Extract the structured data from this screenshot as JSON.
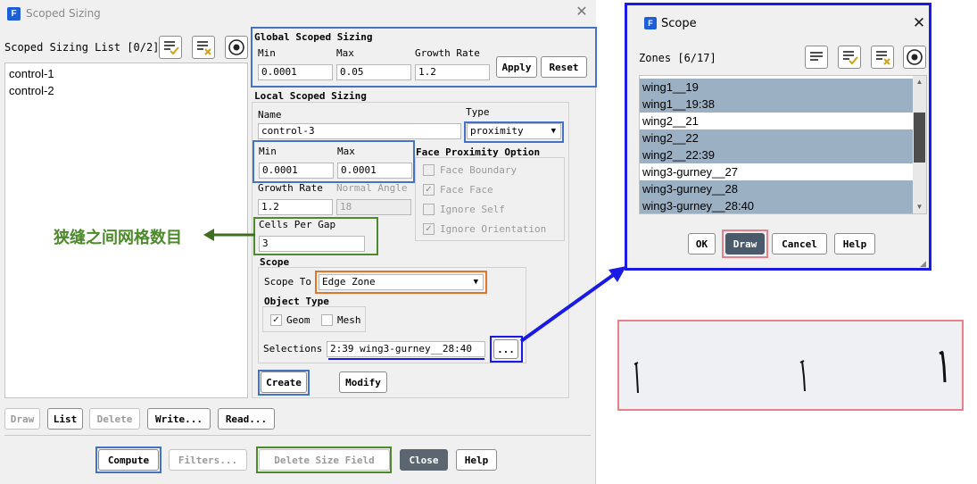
{
  "main_dialog": {
    "title": "Scoped Sizing",
    "close_icon": "close-icon",
    "list_label": "Scoped Sizing List [0/2]",
    "list_items": [
      "control-1",
      "control-2"
    ],
    "global": {
      "title": "Global Scoped Sizing",
      "min_label": "Min",
      "max_label": "Max",
      "growth_label": "Growth Rate",
      "min_value": "0.0001",
      "max_value": "0.05",
      "growth_value": "1.2",
      "apply": "Apply",
      "reset": "Reset"
    },
    "local": {
      "title": "Local Scoped Sizing",
      "name_label": "Name",
      "name_value": "control-3",
      "type_label": "Type",
      "type_value": "proximity",
      "min_label": "Min",
      "max_label": "Max",
      "min_value": "0.0001",
      "max_value": "0.0001",
      "growth_label": "Growth Rate",
      "growth_value": "1.2",
      "normal_angle_label": "Normal Angle",
      "normal_angle_value": "18",
      "cells_label": "Cells Per Gap",
      "cells_value": "3"
    },
    "proximity": {
      "title": "Face Proximity Option",
      "options": [
        {
          "label": "Face Boundary",
          "checked": false
        },
        {
          "label": "Face Face",
          "checked": true
        },
        {
          "label": "Ignore Self",
          "checked": false
        },
        {
          "label": "Ignore Orientation",
          "checked": true
        }
      ]
    },
    "scope": {
      "title": "Scope",
      "scope_to_label": "Scope To",
      "scope_to_value": "Edge Zone",
      "object_type_title": "Object Type",
      "geom_label": "Geom",
      "geom_checked": true,
      "mesh_label": "Mesh",
      "mesh_checked": false,
      "selections_label": "Selections",
      "selections_value": "2:39 wing3-gurney__28:40",
      "browse": "..."
    },
    "create": "Create",
    "modify": "Modify",
    "list_buttons": [
      "Draw",
      "List",
      "Delete",
      "Write...",
      "Read..."
    ],
    "footer_buttons": [
      "Compute",
      "Filters...",
      "Delete Size Field",
      "Close",
      "Help"
    ]
  },
  "annotation": {
    "text": "狭缝之间网格数目",
    "color": "#4c8a2b"
  },
  "scope_dialog": {
    "title": "Scope",
    "zones_label": "Zones [6/17]",
    "zones": [
      {
        "label": "wing1__19",
        "selected": true
      },
      {
        "label": "wing1__19:38",
        "selected": true
      },
      {
        "label": "wing2__21",
        "selected": false
      },
      {
        "label": "wing2__22",
        "selected": true
      },
      {
        "label": "wing2__22:39",
        "selected": true
      },
      {
        "label": "wing3-gurney__27",
        "selected": false
      },
      {
        "label": "wing3-gurney__28",
        "selected": true
      },
      {
        "label": "wing3-gurney__28:40",
        "selected": true
      }
    ],
    "buttons": [
      "OK",
      "Draw",
      "Cancel",
      "Help"
    ]
  },
  "colors": {
    "highlight_blue": "#4472c4",
    "highlight_green": "#4c8a2b",
    "highlight_orange": "#e0762a",
    "highlight_pink": "#e8808c",
    "dialog_border_blue": "#1a1ae6",
    "selection_bg": "#9cb0c4",
    "draw_button_bg": "#4a5a6a"
  }
}
